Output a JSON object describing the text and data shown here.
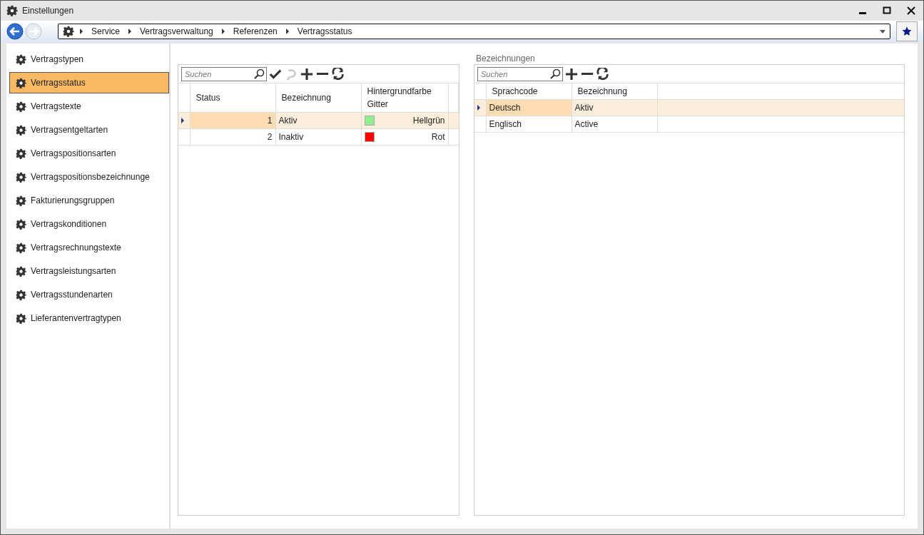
{
  "window": {
    "title": "Einstellungen"
  },
  "breadcrumb": [
    "Service",
    "Vertragsverwaltung",
    "Referenzen",
    "Vertragsstatus"
  ],
  "sidebar": {
    "items": [
      {
        "label": "Vertragstypen",
        "selected": false
      },
      {
        "label": "Vertragsstatus",
        "selected": true
      },
      {
        "label": "Vertragstexte",
        "selected": false
      },
      {
        "label": "Vertragsentgeltarten",
        "selected": false
      },
      {
        "label": "Vertragspositionsarten",
        "selected": false
      },
      {
        "label": "Vertragspositionsbezeichnunge",
        "selected": false
      },
      {
        "label": "Fakturierungsgruppen",
        "selected": false
      },
      {
        "label": "Vertragskonditionen",
        "selected": false
      },
      {
        "label": "Vertragsrechnungstexte",
        "selected": false
      },
      {
        "label": "Vertragsleistungsarten",
        "selected": false
      },
      {
        "label": "Vertragsstundenarten",
        "selected": false
      },
      {
        "label": "Lieferantenvertragtypen",
        "selected": false
      }
    ]
  },
  "status_grid": {
    "search": {
      "placeholder": "Suchen"
    },
    "toolbar": [
      {
        "kind": "apply",
        "disabled": false
      },
      {
        "kind": "undo",
        "disabled": true
      },
      {
        "kind": "add",
        "disabled": false
      },
      {
        "kind": "remove",
        "disabled": false
      },
      {
        "kind": "refresh",
        "disabled": false
      }
    ],
    "columns": [
      "Status",
      "Bezeichnung",
      "Hintergrundfarbe Gitter"
    ],
    "rows": [
      {
        "status": "1",
        "bezeichnung": "Aktiv",
        "color_name": "Hellgrün",
        "color": "#90ee90",
        "selected": true
      },
      {
        "status": "2",
        "bezeichnung": "Inaktiv",
        "color_name": "Rot",
        "color": "#ff0000",
        "selected": false
      }
    ]
  },
  "bezeichnungen": {
    "title": "Bezeichnungen",
    "search": {
      "placeholder": "Suchen"
    },
    "toolbar": [
      {
        "kind": "add",
        "disabled": false
      },
      {
        "kind": "remove",
        "disabled": false
      },
      {
        "kind": "refresh",
        "disabled": false
      }
    ],
    "columns": [
      "Sprachcode",
      "Bezeichnung"
    ],
    "rows": [
      {
        "sprachcode": "Deutsch",
        "bezeichnung": "Aktiv",
        "selected": true
      },
      {
        "sprachcode": "Englisch",
        "bezeichnung": "Active",
        "selected": false
      }
    ]
  }
}
